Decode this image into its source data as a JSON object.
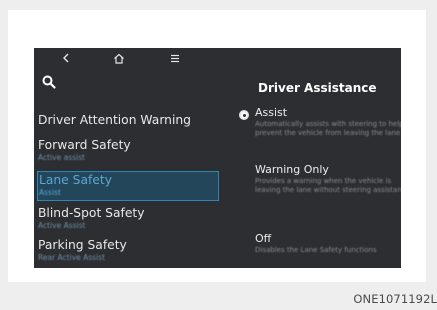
{
  "nav": {
    "back_icon": "back-arrow-icon",
    "home_icon": "home-icon",
    "menu_icon": "menu-icon",
    "search_icon": "search-icon"
  },
  "menu": {
    "items": [
      {
        "label": "Driver Attention Warning",
        "sub": ""
      },
      {
        "label": "Forward Safety",
        "sub": "Active assist"
      },
      {
        "label": "Lane Safety",
        "sub": "Assist"
      },
      {
        "label": "Blind-Spot Safety",
        "sub": "Active Assist"
      },
      {
        "label": "Parking Safety",
        "sub": "Rear Active Assist"
      }
    ],
    "selected_index": 2
  },
  "panel": {
    "title": "Driver Assistance",
    "options": [
      {
        "label": "Assist",
        "desc": "Automatically assists with steering to help prevent the vehicle from leaving the lane",
        "selected": true
      },
      {
        "label": "Warning Only",
        "desc": "Provides a warning when the vehicle is leaving the lane without steering assistance",
        "selected": false
      },
      {
        "label": "Off",
        "desc": "Disables the Lane Safety functions",
        "selected": false
      }
    ]
  },
  "caption": "ONE1071192L",
  "colors": {
    "screen_bg": "#2d2e31",
    "selection_border": "#2d86b6",
    "selection_text": "#5aa6d1"
  }
}
